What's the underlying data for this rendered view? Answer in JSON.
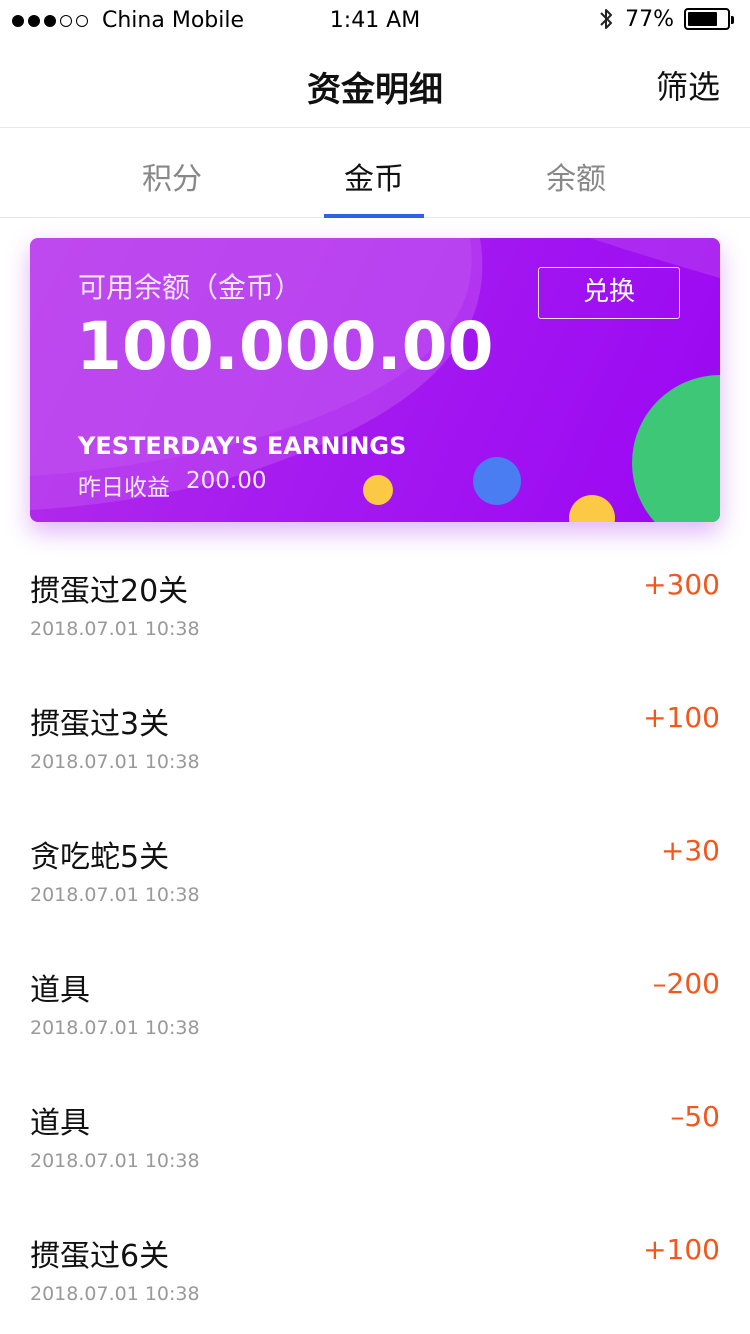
{
  "status_bar": {
    "carrier": "China Mobile",
    "time": "1:41 AM",
    "battery_percent": "77%",
    "battery_level": 0.77,
    "signal_dots": [
      true,
      true,
      true,
      false,
      false
    ],
    "icons": [
      "signal-dots-icon",
      "bluetooth-icon",
      "battery-icon"
    ]
  },
  "nav": {
    "title": "资金明细",
    "filter_label": "筛选"
  },
  "tabs": [
    {
      "label": "积分",
      "active": false
    },
    {
      "label": "金币",
      "active": true
    },
    {
      "label": "余额",
      "active": false
    }
  ],
  "card": {
    "label": "可用余额（金币）",
    "amount": "100.000.00",
    "exchange_label": "兑换",
    "earnings_en": "YESTERDAY'S EARNINGS",
    "earnings_cn_label": "昨日收益",
    "earnings_value": "200.00",
    "colors": {
      "gradient_start": "#b52fe8",
      "gradient_end": "#9a06f3",
      "green_circle": "#3ec776",
      "blue_circle": "#4a7df2",
      "yellow_circle": "#fcc946"
    }
  },
  "transactions": [
    {
      "title": "掼蛋过20关",
      "date": "2018.07.01 10:38",
      "amount": "+300"
    },
    {
      "title": "掼蛋过3关",
      "date": "2018.07.01 10:38",
      "amount": "+100"
    },
    {
      "title": "贪吃蛇5关",
      "date": "2018.07.01 10:38",
      "amount": "+30"
    },
    {
      "title": "道具",
      "date": "2018.07.01 10:38",
      "amount": "–200"
    },
    {
      "title": "道具",
      "date": "2018.07.01 10:38",
      "amount": "–50"
    },
    {
      "title": "掼蛋过6关",
      "date": "2018.07.01 10:38",
      "amount": "+100"
    }
  ],
  "colors": {
    "accent_blue": "#2e60e8",
    "amount_orange": "#f2581d"
  }
}
